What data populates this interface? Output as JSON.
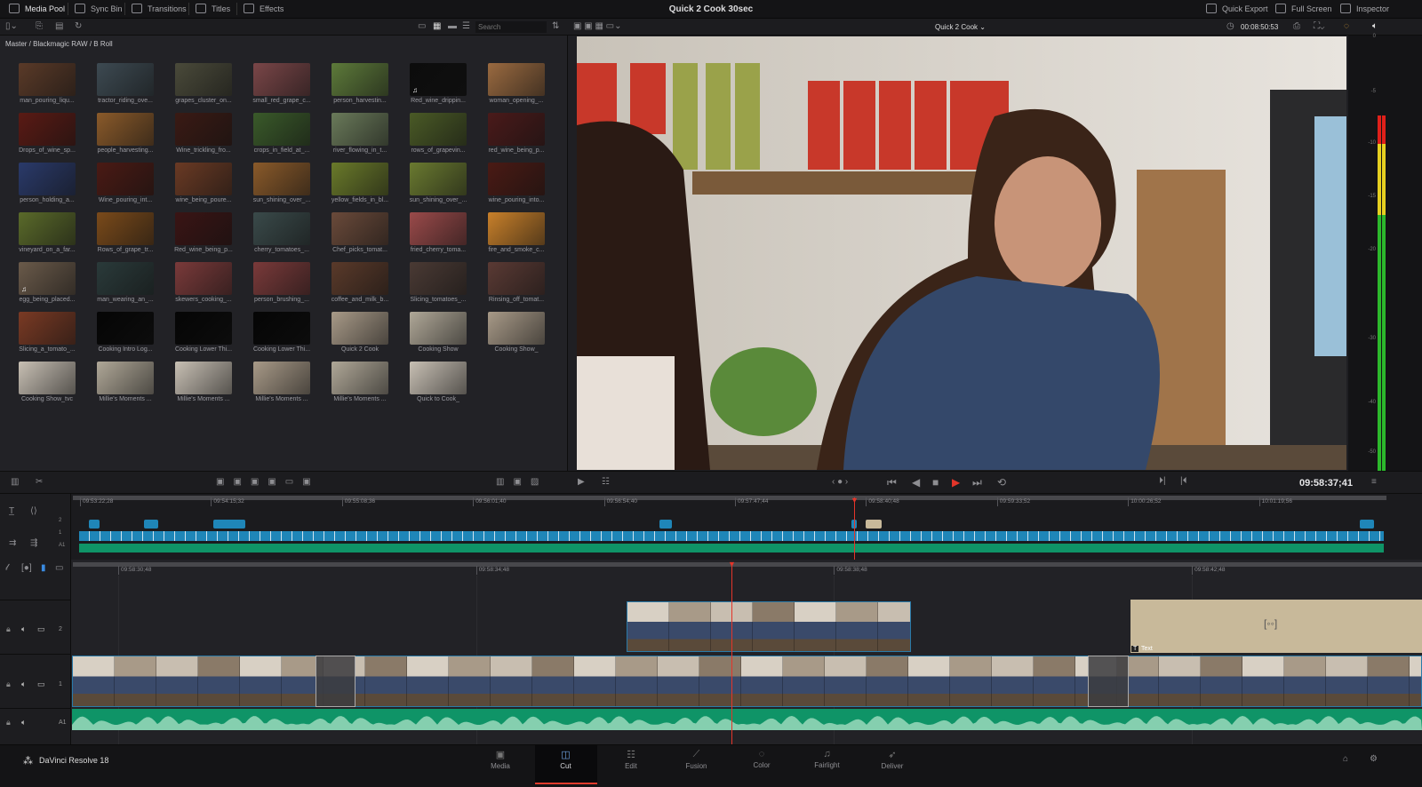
{
  "topbar": {
    "tabs": [
      {
        "label": "Media Pool",
        "icon": "media-pool-icon",
        "active": true
      },
      {
        "label": "Sync Bin",
        "icon": "sync-bin-icon"
      },
      {
        "label": "Transitions",
        "icon": "transitions-icon"
      },
      {
        "label": "Titles",
        "icon": "titles-icon"
      },
      {
        "label": "Effects",
        "icon": "effects-wand-icon"
      }
    ],
    "project_title": "Quick 2 Cook 30sec",
    "right": [
      {
        "label": "Quick Export",
        "icon": "export-icon"
      },
      {
        "label": "Full Screen",
        "icon": "fullscreen-icon"
      },
      {
        "label": "Inspector",
        "icon": "inspector-icon"
      }
    ]
  },
  "media_pool": {
    "search_placeholder": "Search",
    "breadcrumb": "Master / Blackmagic RAW / B Roll",
    "clips": [
      {
        "name": "man_pouring_liqu...",
        "color": "#5a3a28"
      },
      {
        "name": "tractor_riding_ove...",
        "color": "#3d4a52"
      },
      {
        "name": "grapes_cluster_on...",
        "color": "#4a4a3a"
      },
      {
        "name": "small_red_grape_c...",
        "color": "#7a4648"
      },
      {
        "name": "person_harvestin...",
        "color": "#5d7a3a"
      },
      {
        "name": "Red_wine_drippin...",
        "color": "#0c0c0c",
        "audio": true
      },
      {
        "name": "woman_opening_...",
        "color": "#9a6a40"
      },
      {
        "name": "Drops_of_wine_sp...",
        "color": "#5a1a14"
      },
      {
        "name": "people_harvesting...",
        "color": "#8a5a2a"
      },
      {
        "name": "Wine_trickling_fro...",
        "color": "#3a1a14"
      },
      {
        "name": "crops_in_field_at_...",
        "color": "#3a5a2a"
      },
      {
        "name": "river_flowing_in_t...",
        "color": "#6a7a5a"
      },
      {
        "name": "rows_of_grapevin...",
        "color": "#4a5a26"
      },
      {
        "name": "red_wine_being_p...",
        "color": "#4a1a1a"
      },
      {
        "name": "person_holding_a...",
        "color": "#2a3a6a"
      },
      {
        "name": "Wine_pouring_int...",
        "color": "#4a1a14"
      },
      {
        "name": "wine_being_poure...",
        "color": "#6a3a24"
      },
      {
        "name": "sun_shining_over_...",
        "color": "#8a5a2a"
      },
      {
        "name": "yellow_fields_in_bl...",
        "color": "#6a7a2a"
      },
      {
        "name": "sun_shining_over_...",
        "color": "#6a7a30"
      },
      {
        "name": "wine_pouring_into...",
        "color": "#4a1a14"
      },
      {
        "name": "vineyard_on_a_far...",
        "color": "#5a6a2a"
      },
      {
        "name": "Rows_of_grape_tr...",
        "color": "#7a4a1a"
      },
      {
        "name": "Red_wine_being_p...",
        "color": "#3a1414"
      },
      {
        "name": "cherry_tomatoes_...",
        "color": "#3a4a4a"
      },
      {
        "name": "Chef_picks_tomat...",
        "color": "#6a4a3a"
      },
      {
        "name": "fried_cherry_toma...",
        "color": "#9a4a4a"
      },
      {
        "name": "fire_and_smoke_c...",
        "color": "#c8802a"
      },
      {
        "name": "egg_being_placed...",
        "color": "#6a5a4a",
        "audio": true
      },
      {
        "name": "man_wearing_an_...",
        "color": "#2a3a3a"
      },
      {
        "name": "skewers_cooking_...",
        "color": "#7a3a3a"
      },
      {
        "name": "person_brushing_...",
        "color": "#7a3a3a"
      },
      {
        "name": "coffee_and_milk_b...",
        "color": "#5a3a2a"
      },
      {
        "name": "Slicing_tomatoes_...",
        "color": "#4a3a34"
      },
      {
        "name": "Rinsing_off_tomat...",
        "color": "#5a3a34"
      },
      {
        "name": "Slicing_a_tomato_...",
        "color": "#7a3a24"
      },
      {
        "name": "Cooking Intro Log...",
        "color": "#050505"
      },
      {
        "name": "Cooking Lower Thi...",
        "color": "#050505"
      },
      {
        "name": "Cooking Lower Thi...",
        "color": "#050505"
      },
      {
        "name": "Quick 2 Cook",
        "color": "#a89a88"
      },
      {
        "name": "Cooking Show",
        "color": "#b0a898"
      },
      {
        "name": "Cooking Show_",
        "color": "#a89a88"
      },
      {
        "name": "Cooking Show_tvc",
        "color": "#c8c0b4"
      },
      {
        "name": "Millie's Moments ...",
        "color": "#b0a898"
      },
      {
        "name": "Millie's Moments ...",
        "color": "#c8c0b4"
      },
      {
        "name": "Millie's Moments ...",
        "color": "#a89a88"
      },
      {
        "name": "Millie's Moments ...",
        "color": "#b0a898"
      },
      {
        "name": "Quick to Cook_",
        "color": "#c8c0b4"
      }
    ]
  },
  "viewer": {
    "timeline_name": "Quick 2 Cook",
    "duration": "00:08:50:53",
    "timecode": "09:58:37;41",
    "meter_scale": [
      "0",
      "-5",
      "-10",
      "-15",
      "-20",
      "-30",
      "-40",
      "-50"
    ]
  },
  "mini_timeline": {
    "ticks": [
      "09:53:22;28",
      "09:54:15;32",
      "09:55:08;36",
      "09:56:01;40",
      "09:56:54;40",
      "09:57:47;44",
      "09:58:40;48",
      "09:59:33;52",
      "10:00:26;52",
      "10:01:19;56"
    ],
    "tracks": [
      "2",
      "1",
      "A1"
    ]
  },
  "timeline": {
    "ticks": [
      "09:58:30;48",
      "09:58:34;48",
      "09:58:38;48",
      "09:58:42;48"
    ],
    "tracks": [
      "2",
      "1",
      "A1"
    ],
    "text_clip_label": "Text"
  },
  "colors": {
    "video_clip": "#1f86b8",
    "audio_clip": "#0f9467",
    "playhead": "#e4352a",
    "title_clip": "#c8b99a",
    "accent_page": "#e03b2c"
  },
  "bottom": {
    "app_name": "DaVinci Resolve 18",
    "pages": [
      {
        "label": "Media",
        "icon": "media-icon"
      },
      {
        "label": "Cut",
        "icon": "cut-icon",
        "active": true
      },
      {
        "label": "Edit",
        "icon": "edit-icon"
      },
      {
        "label": "Fusion",
        "icon": "fusion-icon"
      },
      {
        "label": "Color",
        "icon": "color-icon"
      },
      {
        "label": "Fairlight",
        "icon": "fairlight-icon"
      },
      {
        "label": "Deliver",
        "icon": "deliver-icon"
      }
    ]
  }
}
